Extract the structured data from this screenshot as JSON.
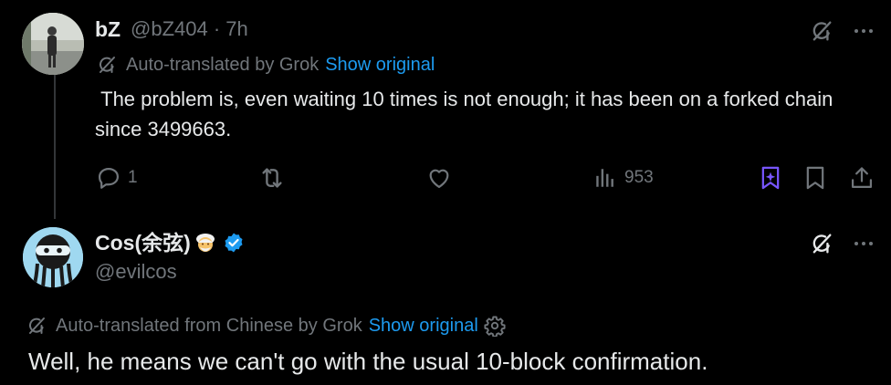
{
  "reply": {
    "name": "bZ",
    "handle_time": "@bZ404 · 7h",
    "translation": {
      "label": "Auto-translated by Grok",
      "show_original": "Show original"
    },
    "text": " The problem is, even waiting 10 times is not enough; it has been on a forked chain since 3499663.",
    "actions": {
      "replies": "1",
      "reposts": "",
      "likes": "",
      "views": "953"
    },
    "icons": [
      "grok-icon",
      "more-icon",
      "translate-icon",
      "reply-icon",
      "repost-icon",
      "like-icon",
      "views-icon",
      "grok-bookmark-icon",
      "bookmark-icon",
      "share-icon"
    ]
  },
  "main": {
    "name": "Cos(余弦)",
    "handle": "@evilcos",
    "translation": {
      "label": "Auto-translated from Chinese by Grok",
      "show_original": "Show original"
    },
    "text": "Well, he means we can't go with the usual 10-block confirmation.",
    "icons": [
      "emoji-icon",
      "verified-badge-icon",
      "grok-icon",
      "more-icon",
      "translate-icon",
      "settings-gear-icon"
    ]
  },
  "colors": {
    "background": "#000000",
    "text": "#e7e9ea",
    "muted": "#71767b",
    "link": "#1d9bf0",
    "grok_purple": "#7856ff",
    "verified_blue": "#1d9bf0"
  }
}
